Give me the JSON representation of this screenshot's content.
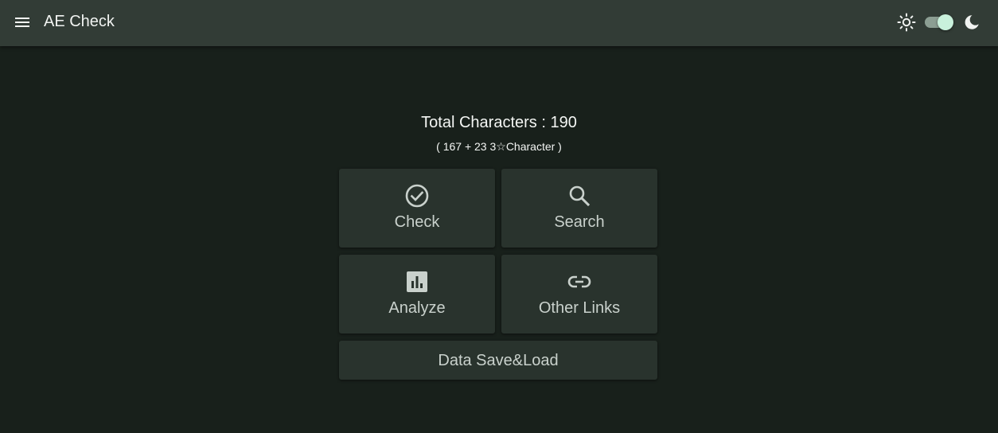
{
  "app": {
    "title": "AE Check"
  },
  "header": {
    "menu_icon": "hamburger-menu-icon",
    "theme": {
      "light_icon": "sun-icon",
      "dark_icon": "moon-icon",
      "dark_mode_on": true
    }
  },
  "summary": {
    "total_label": "Total Characters : 190",
    "breakdown": "( 167 + 23 3☆Character )"
  },
  "menu": {
    "check": {
      "label": "Check",
      "icon": "check-circle-icon"
    },
    "search": {
      "label": "Search",
      "icon": "magnifier-icon"
    },
    "analyze": {
      "label": "Analyze",
      "icon": "bar-chart-icon"
    },
    "links": {
      "label": "Other Links",
      "icon": "link-icon"
    },
    "data": {
      "label": "Data Save&Load"
    }
  },
  "colors": {
    "background": "#18201b",
    "appbar": "#323c36",
    "tile": "#29332d",
    "tile_text": "#c9d1cc",
    "toggle_thumb": "#c9f1dc"
  }
}
